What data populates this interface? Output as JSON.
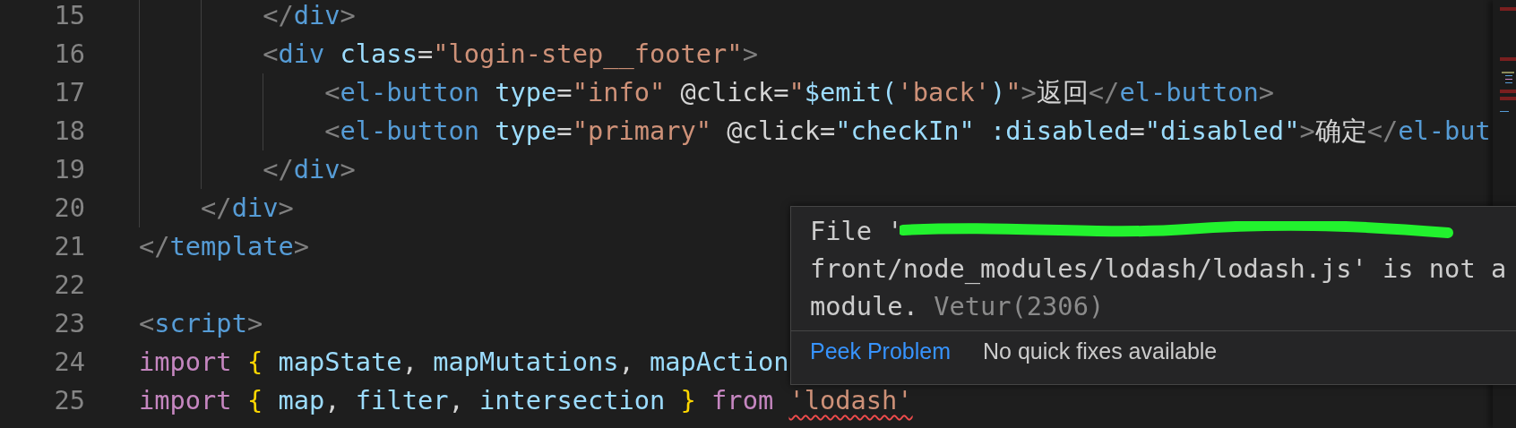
{
  "editor": {
    "lines": [
      {
        "number": "15",
        "code": [
          {
            "kind": "punct",
            "text": "        </"
          },
          {
            "kind": "tag",
            "text": "div"
          },
          {
            "kind": "punct",
            "text": ">"
          }
        ]
      },
      {
        "number": "16",
        "code": [
          {
            "kind": "punct",
            "text": "        <"
          },
          {
            "kind": "tag",
            "text": "div"
          },
          {
            "kind": "attr",
            "text": " class"
          },
          {
            "kind": "plain",
            "text": "="
          },
          {
            "kind": "str",
            "text": "\"login-step__footer\""
          },
          {
            "kind": "punct",
            "text": ">"
          }
        ]
      },
      {
        "number": "17",
        "code": [
          {
            "kind": "punct",
            "text": "            <"
          },
          {
            "kind": "tag",
            "text": "el-button"
          },
          {
            "kind": "attr",
            "text": " type"
          },
          {
            "kind": "plain",
            "text": "="
          },
          {
            "kind": "str",
            "text": "\"info\""
          },
          {
            "kind": "plain",
            "text": " @click="
          },
          {
            "kind": "str",
            "text": "\""
          },
          {
            "kind": "var",
            "text": "$emit("
          },
          {
            "kind": "str",
            "text": "'back'"
          },
          {
            "kind": "var",
            "text": ")"
          },
          {
            "kind": "str",
            "text": "\""
          },
          {
            "kind": "punct",
            "text": ">"
          },
          {
            "kind": "plain",
            "text": "返回"
          },
          {
            "kind": "punct",
            "text": "</"
          },
          {
            "kind": "tag",
            "text": "el-button"
          },
          {
            "kind": "punct",
            "text": ">"
          }
        ]
      },
      {
        "number": "18",
        "code": [
          {
            "kind": "punct",
            "text": "            <"
          },
          {
            "kind": "tag",
            "text": "el-button"
          },
          {
            "kind": "attr",
            "text": " type"
          },
          {
            "kind": "plain",
            "text": "="
          },
          {
            "kind": "str",
            "text": "\"primary\""
          },
          {
            "kind": "plain",
            "text": " @click="
          },
          {
            "kind": "var",
            "text": "\"checkIn\""
          },
          {
            "kind": "attr",
            "text": " :disabled"
          },
          {
            "kind": "plain",
            "text": "="
          },
          {
            "kind": "var",
            "text": "\"disabled\""
          },
          {
            "kind": "punct",
            "text": ">"
          },
          {
            "kind": "plain",
            "text": "确定"
          },
          {
            "kind": "punct",
            "text": "</"
          },
          {
            "kind": "tag",
            "text": "el-but"
          }
        ]
      },
      {
        "number": "19",
        "code": [
          {
            "kind": "punct",
            "text": "        </"
          },
          {
            "kind": "tag",
            "text": "div"
          },
          {
            "kind": "punct",
            "text": ">"
          }
        ]
      },
      {
        "number": "20",
        "code": [
          {
            "kind": "punct",
            "text": "    </"
          },
          {
            "kind": "tag",
            "text": "div"
          },
          {
            "kind": "punct",
            "text": ">"
          }
        ]
      },
      {
        "number": "21",
        "code": [
          {
            "kind": "punct",
            "text": "</"
          },
          {
            "kind": "tag",
            "text": "template"
          },
          {
            "kind": "punct",
            "text": ">"
          }
        ]
      },
      {
        "number": "22"
      },
      {
        "number": "23",
        "code": [
          {
            "kind": "punct",
            "text": "<"
          },
          {
            "kind": "tag",
            "text": "script"
          },
          {
            "kind": "punct",
            "text": ">"
          }
        ]
      },
      {
        "number": "24",
        "code": [
          {
            "kind": "kw",
            "text": "import"
          },
          {
            "kind": "brace",
            "text": " {"
          },
          {
            "kind": "var",
            "text": " mapState"
          },
          {
            "kind": "plain",
            "text": ","
          },
          {
            "kind": "var",
            "text": " mapMutations"
          },
          {
            "kind": "plain",
            "text": ","
          },
          {
            "kind": "var",
            "text": " mapAction"
          }
        ]
      },
      {
        "number": "25",
        "code": [
          {
            "kind": "kw",
            "text": "import"
          },
          {
            "kind": "brace",
            "text": " {"
          },
          {
            "kind": "var",
            "text": " map"
          },
          {
            "kind": "plain",
            "text": ","
          },
          {
            "kind": "var",
            "text": " filter"
          },
          {
            "kind": "plain",
            "text": ","
          },
          {
            "kind": "var",
            "text": " intersection"
          },
          {
            "kind": "brace",
            "text": " }"
          },
          {
            "kind": "kw",
            "text": " from"
          },
          {
            "kind": "str",
            "text": " 'lodash'",
            "error": true
          }
        ]
      }
    ]
  },
  "hover": {
    "message": [
      "File '",
      "front/node_modules/lodash/lodash.js' is not a",
      "module."
    ],
    "redacted": true,
    "source": "Vetur(2306)",
    "action": "Peek Problem",
    "note": "No quick fixes available"
  }
}
